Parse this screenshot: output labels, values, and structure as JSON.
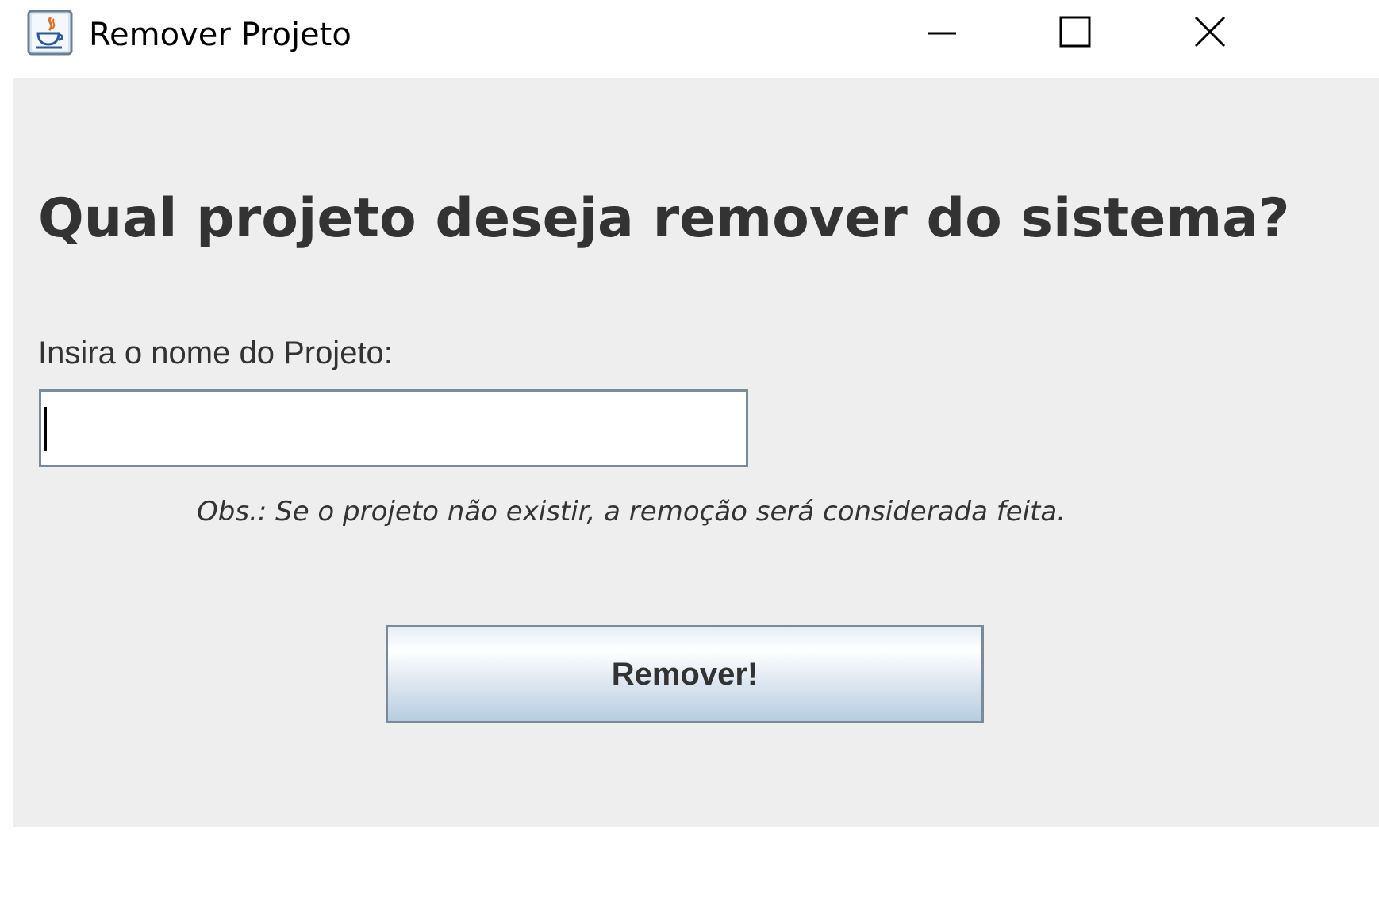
{
  "window": {
    "title": "Remover Projeto",
    "icon": "java-coffee-cup-icon",
    "controls": {
      "minimize_icon": "minimize-icon",
      "maximize_icon": "maximize-icon",
      "close_icon": "close-icon"
    }
  },
  "form": {
    "heading": "Qual projeto deseja remover do sistema?",
    "field_label": "Insira o nome do Projeto:",
    "project_name_value": "",
    "note": "Obs.: Se o projeto não existir, a remoção será considerada feita.",
    "submit_label": "Remover!"
  },
  "colors": {
    "content_background": "#eeeeee",
    "text": "#333333",
    "border": "#7a8a9a"
  }
}
